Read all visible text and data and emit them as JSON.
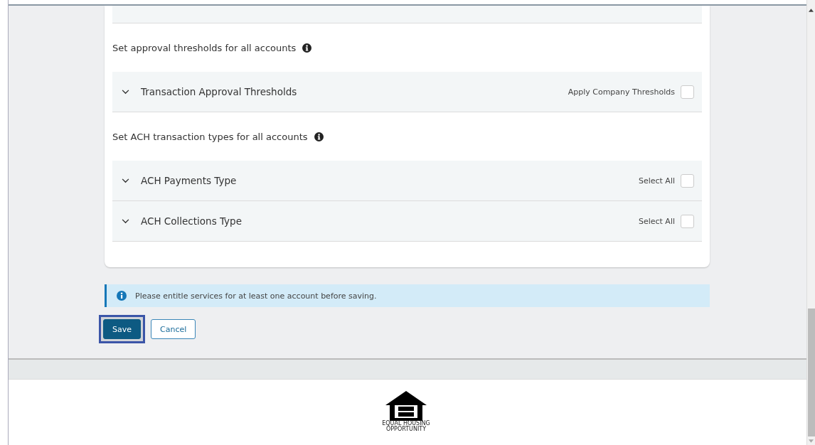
{
  "sections": [
    {
      "heading": "Set approval thresholds for all accounts",
      "rows": [
        {
          "label": "Transaction Approval Thresholds",
          "option": "Apply Company Thresholds",
          "checked": false
        }
      ]
    },
    {
      "heading": "Set ACH transaction types for all accounts",
      "rows": [
        {
          "label": "ACH Payments Type",
          "option": "Select All",
          "checked": false
        },
        {
          "label": "ACH Collections Type",
          "option": "Select All",
          "checked": false
        }
      ]
    }
  ],
  "alert": {
    "message": "Please entitle services for at least one account before saving."
  },
  "buttons": [
    {
      "label": "Save",
      "kind": "primary",
      "focused": true
    },
    {
      "label": "Cancel",
      "kind": "secondary",
      "focused": false
    }
  ],
  "footer": {
    "logo_caption": [
      "EQUAL HOUSING",
      "OPPORTUNITY"
    ]
  }
}
